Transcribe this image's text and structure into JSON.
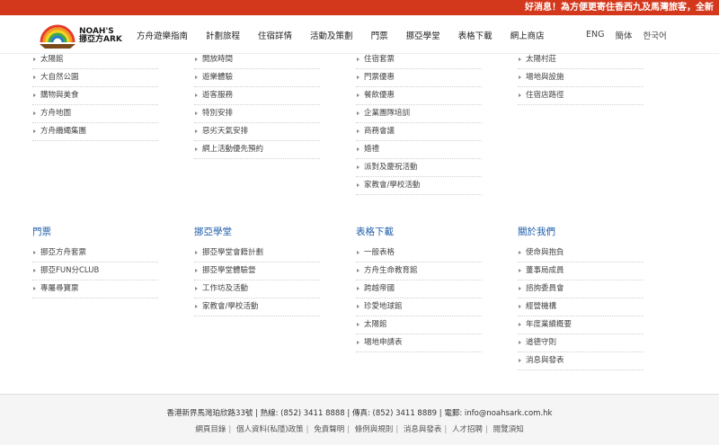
{
  "ticker": "好消息！為方便更寄住香西九及馬灣旅客，全新",
  "logo": {
    "line1": "NOAH'S",
    "line2": "挪亞方ARK"
  },
  "nav": [
    "方舟遊樂指南",
    "計劃旅程",
    "住宿詳情",
    "活動及策劃",
    "門票",
    "挪亞學堂",
    "表格下載",
    "網上商店"
  ],
  "lang": [
    "ENG",
    "簡体",
    "한국어"
  ],
  "top_columns": [
    {
      "items": [
        "太陽館",
        "大自然公園",
        "購物與美食",
        "方舟地圖",
        "方舟纜繩集團"
      ]
    },
    {
      "items": [
        "開放時間",
        "遊樂體驗",
        "遊客服務",
        "特別安排",
        "惡劣天氣安排",
        "網上活動優先預約"
      ]
    },
    {
      "items": [
        "住宿套票",
        "門票優惠",
        "餐飲優惠",
        "企業團隊培訓",
        "商務會議",
        "婚禮",
        "派對及慶祝活動",
        "家教會/學校活動"
      ]
    },
    {
      "items": [
        "太陽村莊",
        "場地與設施",
        "住宿店路徑"
      ]
    }
  ],
  "bottom_columns": [
    {
      "heading": "門票",
      "items": [
        "挪亞方舟套票",
        "挪亞FUN分CLUB",
        "專屬尋寶票"
      ]
    },
    {
      "heading": "挪亞學堂",
      "items": [
        "挪亞學堂會籍計劃",
        "挪亞學堂體驗營",
        "工作坊及活動",
        "家教會/學校活動"
      ]
    },
    {
      "heading": "表格下載",
      "items": [
        "一般表格",
        "方舟生命教育館",
        "跨越帝國",
        "珍愛地球館",
        "太陽館",
        "場地申請表"
      ]
    },
    {
      "heading": "關於我們",
      "items": [
        "使命與抱負",
        "董事局成員",
        "諮詢委員會",
        "經營機構",
        "年度業績概要",
        "道德守則",
        "消息與發表"
      ]
    }
  ],
  "footer": {
    "contact": "香港新界馬灣珀欣路33號 | 熱線: (852) 3411 8888 | 傳真: (852) 3411 8889 | 電郵: info@noahsark.com.hk",
    "links": [
      "網頁目錄",
      "個人資料(私隱)政策",
      "免責聲明",
      "條例與規則",
      "消息與發表",
      "人才招聘",
      "閱覽須知"
    ]
  }
}
